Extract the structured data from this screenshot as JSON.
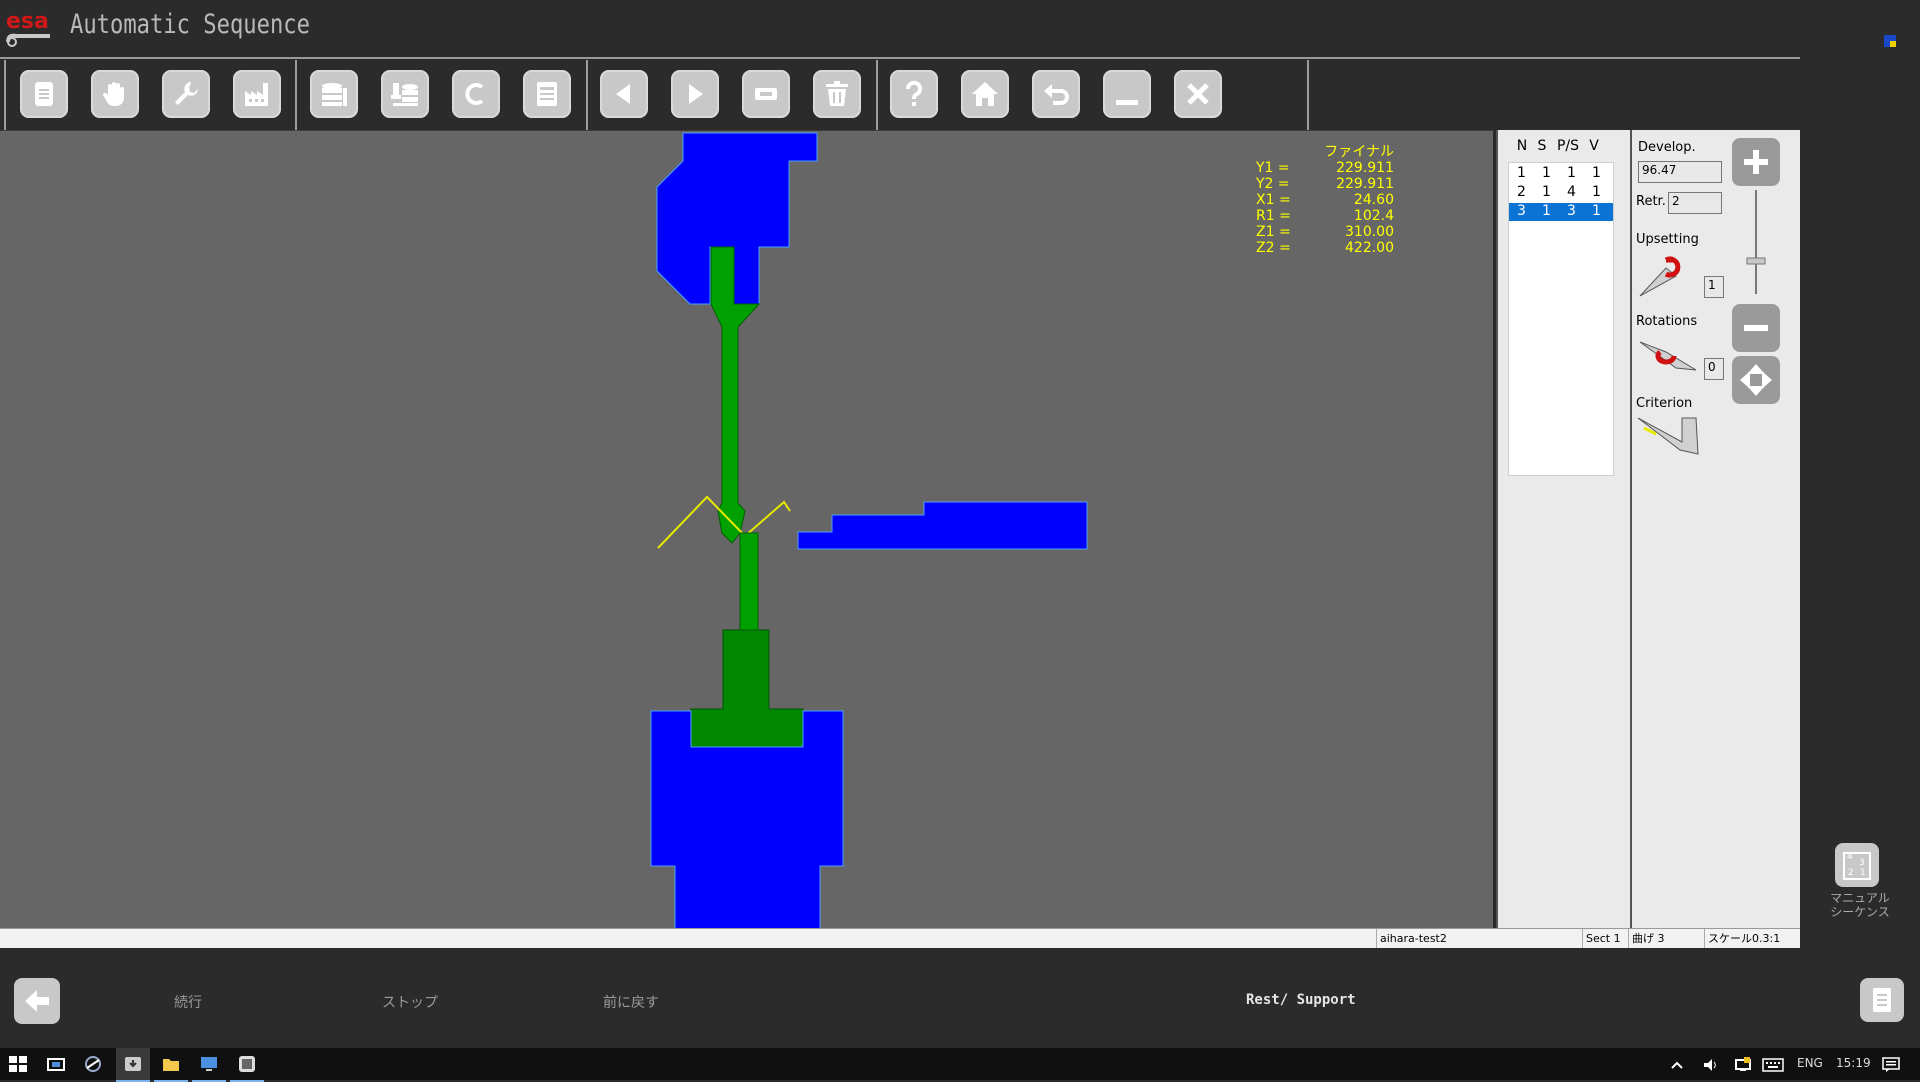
{
  "app": {
    "title": "Automatic Sequence",
    "logo_text": "esa"
  },
  "toolbar": {
    "groups": [
      [
        "document-icon",
        "hand-icon",
        "wrench-icon",
        "factory-icon"
      ],
      [
        "database-list-icon",
        "database-tool-icon",
        "c-icon",
        "printer-icon"
      ],
      [
        "arrow-left-icon",
        "arrow-right-icon",
        "minus-rect-icon",
        "trash-icon"
      ],
      [
        "help-icon",
        "home-icon",
        "undo-icon",
        "minimize-icon",
        "close-icon"
      ]
    ]
  },
  "readout": {
    "title": "ファイナル",
    "rows": [
      {
        "label": "Y1 =",
        "value": "229.911"
      },
      {
        "label": "Y2 =",
        "value": "229.911"
      },
      {
        "label": "X1 =",
        "value": "24.60"
      },
      {
        "label": "R1 =",
        "value": "102.4"
      },
      {
        "label": "Z1 =",
        "value": "310.00"
      },
      {
        "label": "Z2 =",
        "value": "422.00"
      }
    ]
  },
  "sequence": {
    "headers": [
      "N",
      "S",
      "P/S",
      "V"
    ],
    "rows": [
      {
        "n": "1",
        "s": "1",
        "ps": "1",
        "v": "1",
        "selected": false
      },
      {
        "n": "2",
        "s": "1",
        "ps": "4",
        "v": "1",
        "selected": false
      },
      {
        "n": "3",
        "s": "1",
        "ps": "3",
        "v": "1",
        "selected": true
      }
    ]
  },
  "options": {
    "develop_label": "Develop.",
    "develop_value": "96.47",
    "retr_label": "Retr.",
    "retr_value": "2",
    "upsetting_label": "Upsetting",
    "upsetting_value": "1",
    "rotations_label": "Rotations",
    "rotations_value": "0",
    "criterion_label": "Criterion"
  },
  "manual_sequence": {
    "label_line1": "マニュアル",
    "label_line2": "シーケンス"
  },
  "status": {
    "file": "aihara-test2",
    "sect": "Sect  1",
    "bend": "曲げ 3",
    "scale": "スケール0.3:1"
  },
  "commands": {
    "continue": "続行",
    "stop": "ストップ",
    "back": "前に戻す",
    "rest_support": "Rest/ Support"
  },
  "taskbar": {
    "lang": "ENG",
    "time": "15:19"
  },
  "colors": {
    "tool_blue": "#0000ff",
    "part_green": "#009900",
    "highlight": "#0a73d4",
    "readout": "#ffff00"
  }
}
